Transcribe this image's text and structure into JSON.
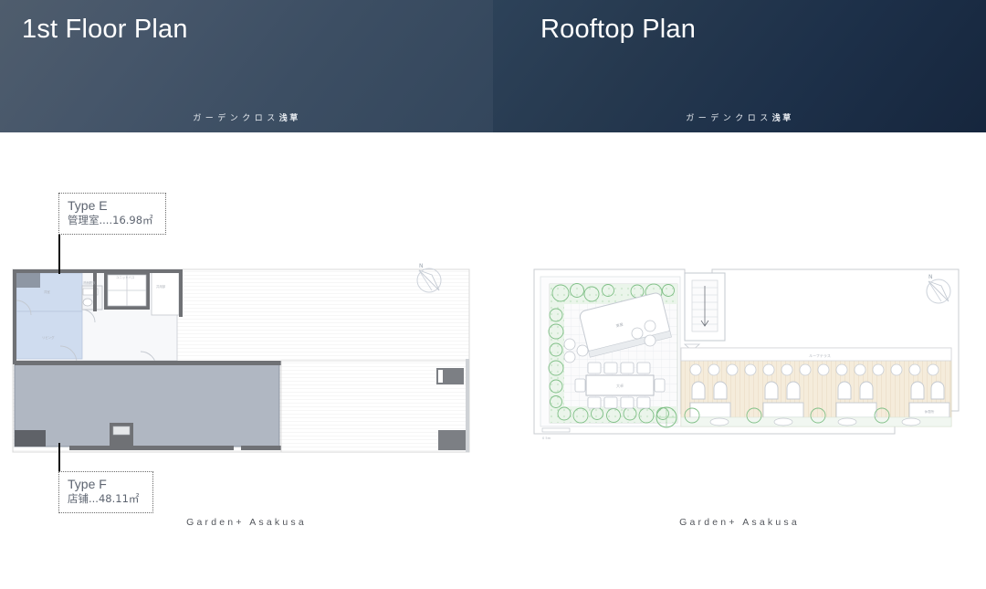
{
  "panels": {
    "left": {
      "title": "1st Floor Plan",
      "subtitle_kana": "ガーデンクロス",
      "subtitle_kanji": "浅草",
      "footer": "Garden+  Asakusa",
      "compass_label": "N"
    },
    "right": {
      "title": "Rooftop Plan",
      "subtitle_kana": "ガーデンクロス",
      "subtitle_kanji": "浅草",
      "footer": "Garden+  Asakusa",
      "compass_label": "N"
    }
  },
  "callouts": [
    {
      "id": "type-e",
      "title": "Type E",
      "desc": "管理室....16.98㎡"
    },
    {
      "id": "type-f",
      "title": "Type F",
      "desc": "店铺...48.11㎡"
    }
  ],
  "colors": {
    "header_left_from": "#4f5d6d",
    "header_left_to": "#33465c",
    "header_right_from": "#2d4259",
    "header_right_to": "#16263d",
    "title_text": "#ffffff",
    "footer_text": "#53565c",
    "callout_text": "#5d6470",
    "wall_dark": "#6f7175",
    "room_blue": "#cfdcef",
    "shop_fill": "#b0b7c2",
    "garden_green": "#8cc48f",
    "deck_beige": "#f3ead8"
  }
}
